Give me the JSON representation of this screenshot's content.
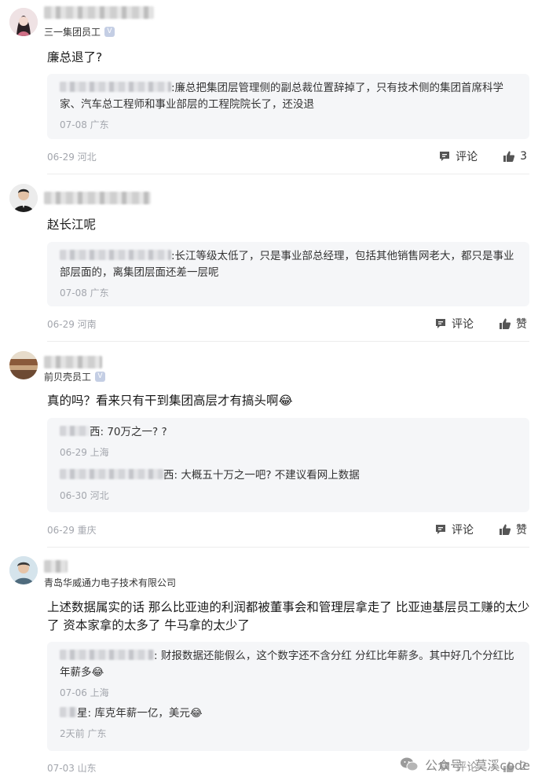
{
  "labels": {
    "comment": "评论",
    "like": "赞"
  },
  "colors": {
    "text": "#1a1a1a",
    "meta": "#a3a6ad",
    "reply_bg": "#f5f6f8",
    "divider": "#ececec"
  },
  "comments": [
    {
      "company": "三一集团员工",
      "verified": true,
      "text": "廉总退了?",
      "replies": [
        {
          "text": ":廉总把集团层管理侧的副总裁位置辞掉了，只有技术侧的集团首席科学家、汽车总工程师和事业部层的工程院院长了，还没退",
          "meta": "07-08 广东"
        }
      ],
      "meta": "06-29 河北",
      "like_label": "3"
    },
    {
      "company": "",
      "verified": false,
      "text": "赵长江呢",
      "replies": [
        {
          "text": ":长江等级太低了，只是事业部总经理，包括其他销售网老大，都只是事业部层面的，离集团层面还差一层呢",
          "meta": "07-08 广东"
        }
      ],
      "meta": "06-29 河南",
      "like_label": "赞"
    },
    {
      "company": "前贝壳员工",
      "verified": true,
      "text": "真的吗？看来只有干到集团高层才有搞头啊😂",
      "replies": [
        {
          "text": "西: 70万之一? ?",
          "meta": "06-29 上海"
        },
        {
          "text": "西: 大概五十万之一吧? 不建议看网上数据",
          "meta": "06-30 河北"
        }
      ],
      "meta": "06-29 重庆",
      "like_label": "赞"
    },
    {
      "company": "青岛华威通力电子技术有限公司",
      "verified": false,
      "text": "上述数据属实的话 那么比亚迪的利润都被董事会和管理层拿走了 比亚迪基层员工赚的太少了 资本家拿的太多了 牛马拿的太少了",
      "replies": [
        {
          "text": ": 财报数据还能假么，这个数字还不含分红 分红比年薪多。其中好几个分红比年薪多😂",
          "meta": "07-06 上海"
        },
        {
          "text": "星: 库克年薪一亿，美元😂",
          "meta": "2天前 广东"
        }
      ],
      "meta": "07-03 山东",
      "like_label": "2"
    }
  ],
  "watermark": {
    "text": "公众号 · 莫溪code",
    "icon": "wechat-icon"
  }
}
